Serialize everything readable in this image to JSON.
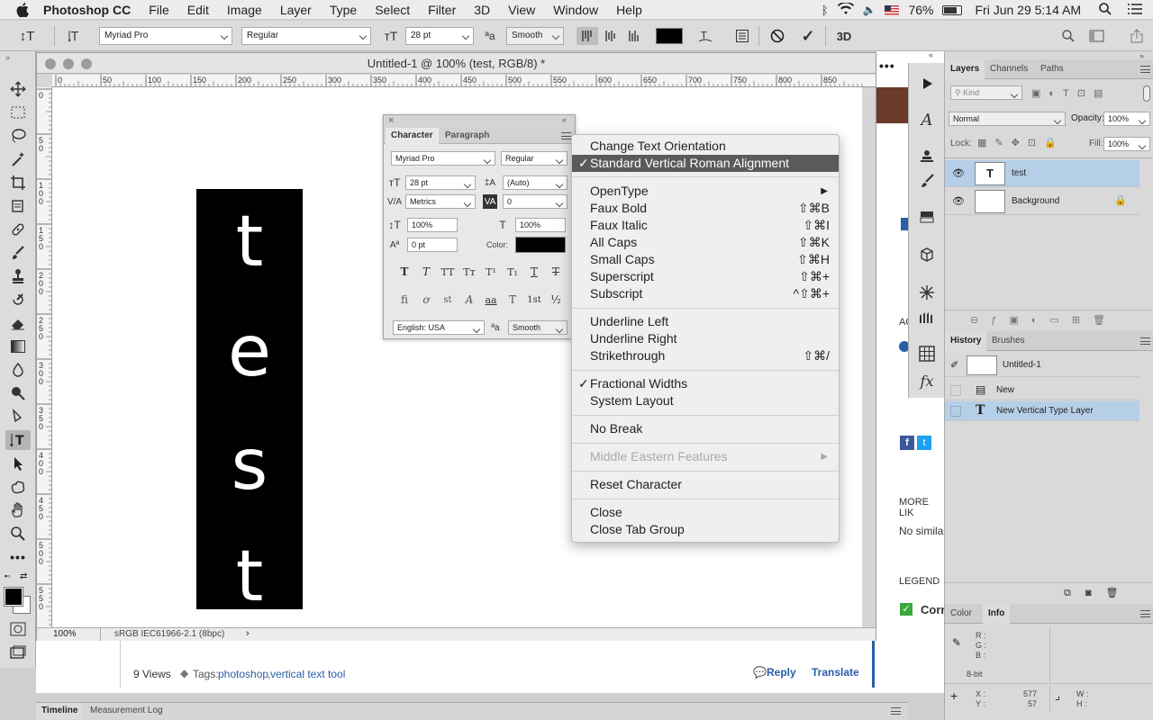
{
  "menubar": {
    "app_name": "Photoshop CC",
    "items": [
      "File",
      "Edit",
      "Image",
      "Layer",
      "Type",
      "Select",
      "Filter",
      "3D",
      "View",
      "Window",
      "Help"
    ],
    "battery": "76%",
    "clock": "Fri Jun 29  5:14 AM"
  },
  "options_bar": {
    "font_family": "Myriad Pro",
    "font_style": "Regular",
    "font_size": "28 pt",
    "antialias": "Smooth",
    "text_color": "#000000",
    "label_3d": "3D"
  },
  "document": {
    "title": "Untitled-1 @ 100% (test, RGB/8) *",
    "zoom": "100%",
    "profile": "sRGB IEC61966-2.1 (8bpc)",
    "glyphs": [
      "t",
      "e",
      "s",
      "t"
    ],
    "ruler_h": [
      "0",
      "50",
      "100",
      "150",
      "200",
      "250",
      "300",
      "350",
      "400",
      "450",
      "500",
      "550",
      "600",
      "650",
      "700",
      "750",
      "800",
      "850"
    ],
    "ruler_v": [
      "0",
      "5\n0",
      "1\n0\n0",
      "1\n5\n0",
      "2\n0\n0",
      "2\n5\n0",
      "3\n0\n0",
      "3\n5\n0",
      "4\n0\n0",
      "4\n5\n0",
      "5\n0\n0",
      "5\n5\n0"
    ]
  },
  "character_panel": {
    "tab_character": "Character",
    "tab_paragraph": "Paragraph",
    "font_family": "Myriad Pro",
    "font_style": "Regular",
    "size": "28 pt",
    "leading": "(Auto)",
    "kerning": "Metrics",
    "tracking": "0",
    "vscale": "100%",
    "hscale": "100%",
    "baseline": "0 pt",
    "color_label": "Color:",
    "color": "#000000",
    "language": "English: USA",
    "antialias": "Smooth",
    "type_buttons": [
      "T",
      "T",
      "TT",
      "Tт",
      "T¹",
      "T₁",
      "T",
      "T"
    ],
    "ot_buttons": [
      "ﬁ",
      "ơ",
      "st",
      "A",
      "aa",
      "T",
      "1st",
      "½"
    ]
  },
  "context_menu": {
    "items": [
      {
        "label": "Change Text Orientation",
        "shortcut": "",
        "check": "",
        "arrow": ""
      },
      {
        "label": "Standard Vertical Roman Alignment",
        "shortcut": "",
        "check": "✓",
        "arrow": ""
      },
      {
        "label": "OpenType",
        "shortcut": "",
        "check": "",
        "arrow": "▶"
      },
      {
        "label": "Faux Bold",
        "shortcut": "⇧⌘B",
        "check": "",
        "arrow": ""
      },
      {
        "label": "Faux Italic",
        "shortcut": "⇧⌘I",
        "check": "",
        "arrow": ""
      },
      {
        "label": "All Caps",
        "shortcut": "⇧⌘K",
        "check": "",
        "arrow": ""
      },
      {
        "label": "Small Caps",
        "shortcut": "⇧⌘H",
        "check": "",
        "arrow": ""
      },
      {
        "label": "Superscript",
        "shortcut": "⇧⌘+",
        "check": "",
        "arrow": ""
      },
      {
        "label": "Subscript",
        "shortcut": "^⇧⌘+",
        "check": "",
        "arrow": ""
      },
      {
        "label": "Underline Left",
        "shortcut": "",
        "check": "",
        "arrow": ""
      },
      {
        "label": "Underline Right",
        "shortcut": "",
        "check": "",
        "arrow": ""
      },
      {
        "label": "Strikethrough",
        "shortcut": "⇧⌘/",
        "check": "",
        "arrow": ""
      },
      {
        "label": "Fractional Widths",
        "shortcut": "",
        "check": "✓",
        "arrow": ""
      },
      {
        "label": "System Layout",
        "shortcut": "",
        "check": "",
        "arrow": ""
      },
      {
        "label": "No Break",
        "shortcut": "",
        "check": "",
        "arrow": ""
      },
      {
        "label": "Middle Eastern Features",
        "shortcut": "",
        "check": "",
        "arrow": "▶"
      },
      {
        "label": "Reset Character",
        "shortcut": "",
        "check": "",
        "arrow": ""
      },
      {
        "label": "Close",
        "shortcut": "",
        "check": "",
        "arrow": ""
      },
      {
        "label": "Close Tab Group",
        "shortcut": "",
        "check": "",
        "arrow": ""
      }
    ]
  },
  "layers_panel": {
    "tabs": [
      "Layers",
      "Channels",
      "Paths"
    ],
    "filter": "Kind",
    "blend_mode": "Normal",
    "opacity_label": "Opacity:",
    "opacity": "100%",
    "lock_label": "Lock:",
    "fill_label": "Fill:",
    "fill": "100%",
    "layers": [
      {
        "name": "test",
        "thumb": "T"
      },
      {
        "name": "Background",
        "thumb": ""
      }
    ]
  },
  "history_panel": {
    "tabs": [
      "History",
      "Brushes"
    ],
    "snapshot": "Untitled-1",
    "states": [
      "New",
      "New Vertical Type Layer"
    ]
  },
  "info_panel": {
    "tabs": [
      "Color",
      "Info"
    ],
    "rgb_labels": [
      "R :",
      "G :",
      "B :"
    ],
    "bit_depth": "8-bit",
    "x_label": "X :",
    "y_label": "Y :",
    "x": "577",
    "y": "57",
    "w_label": "W :",
    "h_label": "H :"
  },
  "background_page": {
    "views": "9 Views",
    "tags_label": "Tags:",
    "tag1": "photoshop",
    "tag2": "vertical text tool",
    "reply": "Reply",
    "translate": "Translate",
    "side_ac": "AC",
    "more_like": "MORE LIK",
    "no_similar": "No simila",
    "legend": "LEGEND",
    "corr": "Corr"
  },
  "bottom_panel": {
    "tabs": [
      "Timeline",
      "Measurement Log"
    ]
  },
  "colors": {
    "selected_row": "#b6cfe8",
    "menu_highlight": "#5a5a5a",
    "link": "#2a5ea8"
  }
}
